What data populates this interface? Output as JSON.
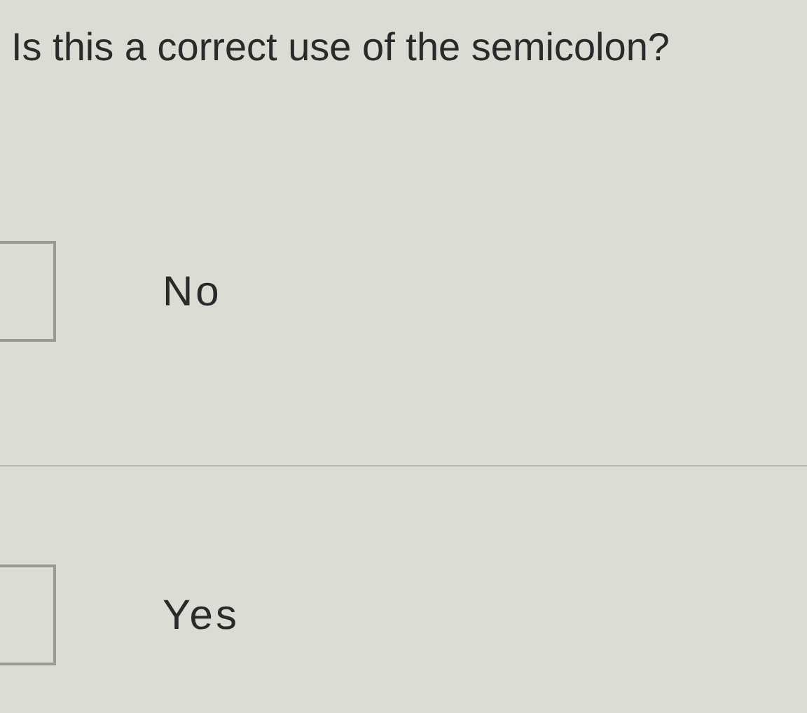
{
  "question": "Is this a correct use of the semicolon?",
  "options": [
    {
      "label": "No",
      "checked": false
    },
    {
      "label": "Yes",
      "checked": false
    }
  ]
}
